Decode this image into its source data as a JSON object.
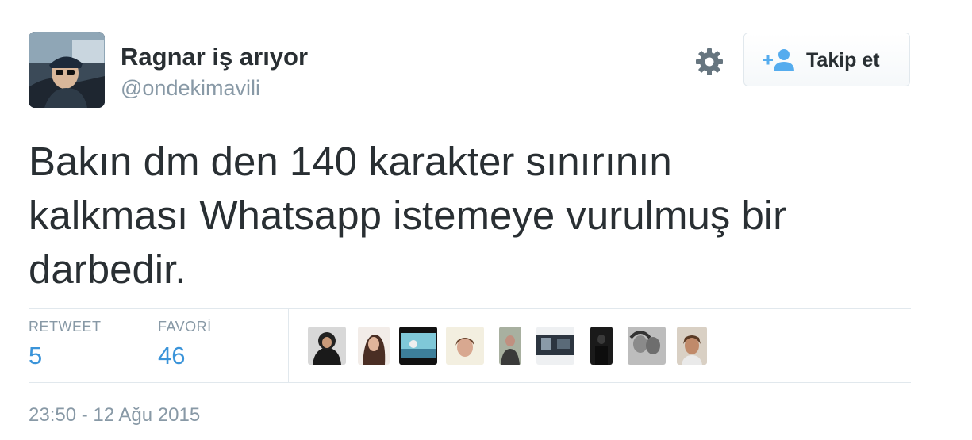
{
  "user": {
    "display_name": "Ragnar iş arıyor",
    "handle": "@ondekimavili"
  },
  "actions": {
    "settings_icon": "gear-icon",
    "follow_label": "Takip et",
    "follow_icon": "add-user-icon"
  },
  "tweet": {
    "lines": [
      "Bakın dm den 140 karakter sınırının",
      "kalkması Whatsapp istemeye vurulmuş bir",
      "darbedir."
    ]
  },
  "stats": {
    "retweet_label": "RETWEET",
    "retweet_count": "5",
    "favorite_label": "FAVORİ",
    "favorite_count": "46"
  },
  "timestamp": "23:50 - 12 Ağu 2015",
  "colors": {
    "text": "#292f33",
    "muted": "#8899a6",
    "link": "#3b94d9",
    "border": "#e1e8ed"
  }
}
